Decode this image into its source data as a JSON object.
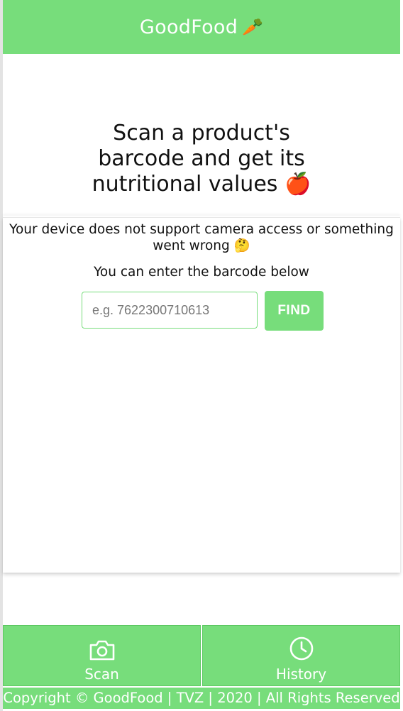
{
  "header": {
    "title": "GoodFood",
    "logo_icon": "🥕"
  },
  "headline": {
    "line1": "Scan a product's",
    "line2": "barcode and get its",
    "line3": "nutritional values",
    "emoji": "🍎"
  },
  "scanner": {
    "error_message": "Your device does not support camera access or something went wrong",
    "error_emoji": "🤔",
    "hint": "You can enter the barcode below",
    "input_value": "",
    "input_placeholder": "e.g. 7622300710613",
    "find_label": "FIND"
  },
  "nav": {
    "items": [
      {
        "label": "Scan",
        "icon": "camera-icon"
      },
      {
        "label": "History",
        "icon": "clock-icon"
      }
    ]
  },
  "footer": {
    "text": "Copyright © GoodFood | TVZ | 2020 | All Rights Reserved"
  },
  "colors": {
    "brand_green": "#77dd7b",
    "text": "#111111"
  }
}
